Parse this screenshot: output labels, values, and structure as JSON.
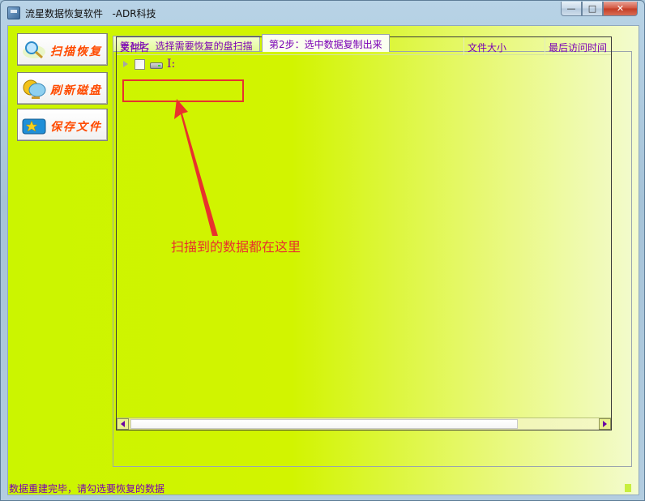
{
  "window": {
    "title": "流星数据恢复软件   -ADR科技",
    "min_symbol": "—",
    "max_symbol": "□",
    "close_symbol": "✕"
  },
  "sidebar": {
    "buttons": [
      {
        "label": "扫描恢复",
        "icon": "magnifier-icon"
      },
      {
        "label": "刷新磁盘",
        "icon": "globe-balloon-icon"
      },
      {
        "label": "保存文件",
        "icon": "star-folder-icon"
      }
    ]
  },
  "tabs": [
    {
      "label": "第1步：选择需要恢复的盘扫描",
      "active": false
    },
    {
      "label": "第2步：选中数据复制出来",
      "active": true
    }
  ],
  "file_list": {
    "columns": [
      "文件名",
      "文件大小",
      "最后访问时间"
    ],
    "rows": [
      {
        "name": "I:",
        "size": "",
        "time": "",
        "checked": false,
        "expanded": false
      }
    ]
  },
  "annotation": {
    "text": "扫描到的数据都在这里",
    "color": "#e8322d"
  },
  "status": {
    "text": "数据重建完毕，请勾选要恢复的数据"
  },
  "colors": {
    "accent_text": "#7a00b5",
    "button_text": "#ff4b00",
    "background_lime": "#cbf500"
  }
}
